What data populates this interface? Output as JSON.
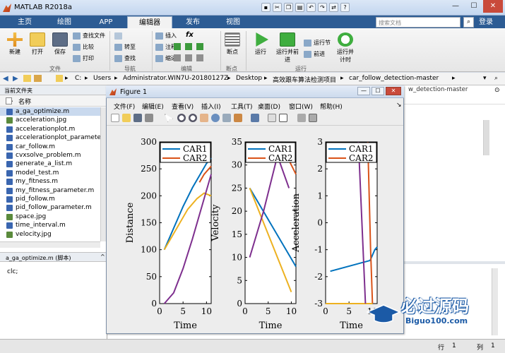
{
  "window": {
    "title": "MATLAB R2018a",
    "search_placeholder": "搜索文档",
    "login": "登录"
  },
  "tabs": [
    {
      "label": "主页"
    },
    {
      "label": "绘图"
    },
    {
      "label": "APP"
    },
    {
      "label": "编辑器"
    },
    {
      "label": "发布"
    },
    {
      "label": "视图"
    }
  ],
  "ribbon": {
    "file": {
      "section": "文件",
      "new": "新建",
      "open": "打开",
      "save": "保存",
      "find_files": "查找文件",
      "compare": "比较",
      "print": "打印"
    },
    "nav": {
      "section": "导航",
      "goto": "转至",
      "find": "查找"
    },
    "edit": {
      "section": "编辑",
      "insert": "插入",
      "comment": "注释",
      "indent": "缩进",
      "fx": "fx"
    },
    "breakpoints": {
      "section": "断点",
      "label": "断点"
    },
    "run": {
      "section": "运行",
      "run": "运行",
      "run_advance": "运行并前进",
      "run_section": "运行节",
      "advance": "前进",
      "run_time": "运行并计时"
    }
  },
  "address": {
    "path": [
      "C:",
      "Users",
      "Administrator.WIN7U-20180127Z",
      "Desktop",
      "高效跟车算法检测项目",
      "car_follow_detection-master"
    ]
  },
  "current_folder": {
    "header": "当前文件夹",
    "col_name": "名称",
    "files": [
      {
        "name": "a_ga_optimize.m",
        "type": "m"
      },
      {
        "name": "acceleration.jpg",
        "type": "img"
      },
      {
        "name": "accelerationplot.m",
        "type": "m"
      },
      {
        "name": "accelerationplot_parameter",
        "type": "m"
      },
      {
        "name": "car_follow.m",
        "type": "m"
      },
      {
        "name": "cvxsolve_problem.m",
        "type": "m"
      },
      {
        "name": "generate_a_list.m",
        "type": "m"
      },
      {
        "name": "model_test.m",
        "type": "m"
      },
      {
        "name": "my_fitness.m",
        "type": "m"
      },
      {
        "name": "my_fitness_parameter.m",
        "type": "m"
      },
      {
        "name": "pid_follow.m",
        "type": "m"
      },
      {
        "name": "pid_follow_parameter.m",
        "type": "m"
      },
      {
        "name": "space.jpg",
        "type": "img"
      },
      {
        "name": "time_interval.m",
        "type": "m"
      },
      {
        "name": "velocity.jpg",
        "type": "img"
      }
    ],
    "details_title": "a_ga_optimize.m  (脚本)",
    "code_line": "clc;"
  },
  "editor": {
    "tab_title": "w_detection-master"
  },
  "statusbar": {
    "row_label": "行",
    "row": "1",
    "col_label": "列",
    "col": "1"
  },
  "figure": {
    "title": "Figure 1",
    "menu": [
      "文件(F)",
      "编辑(E)",
      "查看(V)",
      "插入(I)",
      "工具(T)",
      "桌面(D)",
      "窗口(W)",
      "帮助(H)"
    ]
  },
  "watermark": {
    "text": "必过源码",
    "url": "Biguo100.com"
  },
  "colors": {
    "car1": "#0072bd",
    "car2": "#d95319",
    "yellow": "#edb120",
    "purple": "#7e2f8e"
  },
  "chart_data": [
    {
      "type": "line",
      "xlabel": "Time",
      "ylabel": "Distance",
      "xlim": [
        0,
        11
      ],
      "ylim": [
        0,
        300
      ],
      "xticks": [
        0,
        5,
        10
      ],
      "yticks": [
        0,
        50,
        100,
        150,
        200,
        250,
        300
      ],
      "legend": [
        "CAR1",
        "CAR2"
      ],
      "legend_position": "top",
      "series": [
        {
          "name": "CAR1",
          "color": "#0072bd",
          "x": [
            1,
            3,
            5,
            7,
            9,
            10,
            11
          ],
          "y": [
            100,
            140,
            180,
            215,
            245,
            260,
            270
          ]
        },
        {
          "name": "CAR2",
          "color": "#d95319",
          "x": [
            8.5,
            9.5,
            10.5,
            11
          ],
          "y": [
            225,
            240,
            250,
            255
          ]
        },
        {
          "color": "#edb120",
          "x": [
            1,
            2,
            4,
            6,
            8,
            9.5,
            11
          ],
          "y": [
            100,
            115,
            145,
            175,
            195,
            205,
            200
          ]
        },
        {
          "color": "#7e2f8e",
          "x": [
            1,
            3,
            5,
            7,
            9,
            11
          ],
          "y": [
            0,
            20,
            65,
            120,
            180,
            240
          ]
        }
      ]
    },
    {
      "type": "line",
      "xlabel": "Time",
      "ylabel": "Velocity",
      "xlim": [
        0,
        11
      ],
      "ylim": [
        0,
        35
      ],
      "xticks": [
        0,
        5,
        10
      ],
      "yticks": [
        0,
        5,
        10,
        15,
        20,
        25,
        30,
        35
      ],
      "legend": [
        "CAR1",
        "CAR2"
      ],
      "legend_position": "top",
      "series": [
        {
          "name": "CAR1",
          "color": "#0072bd",
          "x": [
            1,
            11
          ],
          "y": [
            25,
            8
          ]
        },
        {
          "name": "CAR2",
          "color": "#d95319",
          "x": [
            9,
            10,
            11
          ],
          "y": [
            32,
            30,
            28
          ]
        },
        {
          "color": "#edb120",
          "x": [
            1,
            10
          ],
          "y": [
            25,
            2.5
          ]
        },
        {
          "color": "#7e2f8e",
          "x": [
            1,
            4,
            7,
            9.5
          ],
          "y": [
            10,
            20,
            32,
            25
          ]
        }
      ]
    },
    {
      "type": "line",
      "xlabel": "Time",
      "ylabel": "Acceleration",
      "xlim": [
        0,
        11
      ],
      "ylim": [
        -3,
        3
      ],
      "xticks": [
        0,
        5,
        10
      ],
      "yticks": [
        -3,
        -2,
        -1,
        0,
        1,
        2,
        3
      ],
      "legend": [
        "CAR1",
        "CAR2"
      ],
      "legend_position": "top",
      "series": [
        {
          "name": "CAR1",
          "color": "#0072bd",
          "x": [
            1,
            9.5,
            10.5,
            11
          ],
          "y": [
            -1.8,
            -1.4,
            -1.0,
            -0.9
          ]
        },
        {
          "name": "CAR2",
          "color": "#d95319",
          "x": [
            9,
            9.3,
            9.6,
            10
          ],
          "y": [
            3,
            1,
            -1,
            -3
          ]
        },
        {
          "color": "#edb120",
          "x": [
            0,
            5,
            9,
            10
          ],
          "y": [
            -3,
            -3,
            -3,
            -3
          ]
        },
        {
          "color": "#7e2f8e",
          "x": [
            7,
            7.5,
            8,
            8.5
          ],
          "y": [
            3,
            1,
            -1,
            -3
          ]
        }
      ]
    }
  ]
}
